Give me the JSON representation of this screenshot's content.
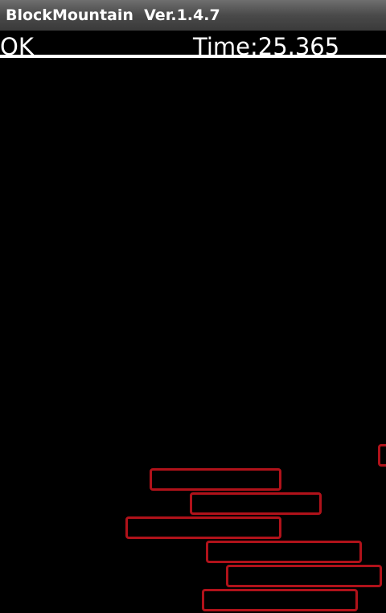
{
  "app": {
    "title": "BlockMountain",
    "version": "Ver.1.4.7"
  },
  "hud": {
    "status": "OK",
    "time_label": "Time:25.365"
  },
  "colors": {
    "block_outline": "#b0121a",
    "background": "#000000",
    "divider": "#ffffff"
  }
}
